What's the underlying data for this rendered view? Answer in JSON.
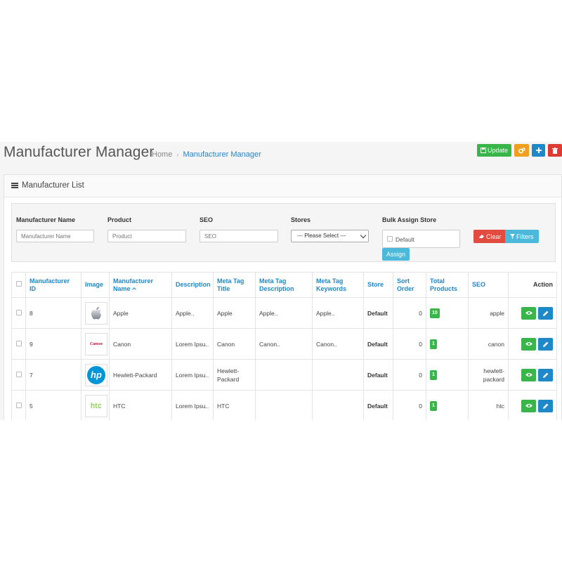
{
  "header": {
    "title": "Manufacturer Manager",
    "breadcrumb": [
      "Home",
      "Manufacturer Manager"
    ],
    "actions": {
      "update_label": "Update"
    }
  },
  "panel": {
    "title": "Manufacturer List"
  },
  "filters": {
    "manufacturer_name_label": "Manufacturer Name",
    "manufacturer_name_placeholder": "Manufacturer Name",
    "product_label": "Product",
    "product_placeholder": "Product",
    "seo_label": "SEO",
    "seo_placeholder": "SEO",
    "stores_label": "Stores",
    "stores_selected": "--- Please Select ---",
    "bulk_assign_label": "Bulk Assign Store",
    "store_option": "Default",
    "assign_label": "Assign",
    "clear_label": "Clear",
    "filters_label": "Filters"
  },
  "table": {
    "columns": [
      "Manufacturer ID",
      "Image",
      "Manufacturer Name",
      "Description",
      "Meta Tag Title",
      "Meta Tag Description",
      "Meta Tag Keywords",
      "Store",
      "Sort Order",
      "Total Products",
      "SEO",
      "Action"
    ],
    "rows": [
      {
        "id": "8",
        "logo": "apple-logo",
        "name": "Apple",
        "description": "Apple..",
        "meta_title": "Apple",
        "meta_description": "Apple..",
        "meta_keywords": "Apple..",
        "store": "Default",
        "sort_order": "0",
        "total_products": "10",
        "seo": "apple"
      },
      {
        "id": "9",
        "logo": "canon-logo",
        "logo_text": "Canon",
        "name": "Canon",
        "description": "Lorem Ipsu..",
        "meta_title": "Canon",
        "meta_description": "Canon..",
        "meta_keywords": "Canon..",
        "store": "Default",
        "sort_order": "0",
        "total_products": "1",
        "seo": "canon"
      },
      {
        "id": "7",
        "logo": "hp-logo",
        "logo_text": "hp",
        "name": "Hewlett-Packard",
        "description": "Lorem Ipsu..",
        "meta_title": "Hewlett-Packard",
        "meta_description": "",
        "meta_keywords": "",
        "store": "Default",
        "sort_order": "0",
        "total_products": "1",
        "seo": "hewlett-packard"
      },
      {
        "id": "5",
        "logo": "htc-logo",
        "logo_text": "htc",
        "name": "HTC",
        "description": "Lorem Ipsu..",
        "meta_title": "HTC",
        "meta_description": "",
        "meta_keywords": "",
        "store": "Default",
        "sort_order": "0",
        "total_products": "1",
        "seo": "htc"
      }
    ]
  },
  "colors": {
    "primary": "#1e88c9",
    "success": "#39b54a",
    "warning": "#f0a01e",
    "danger": "#dd3a33",
    "info": "#4cb8da"
  }
}
